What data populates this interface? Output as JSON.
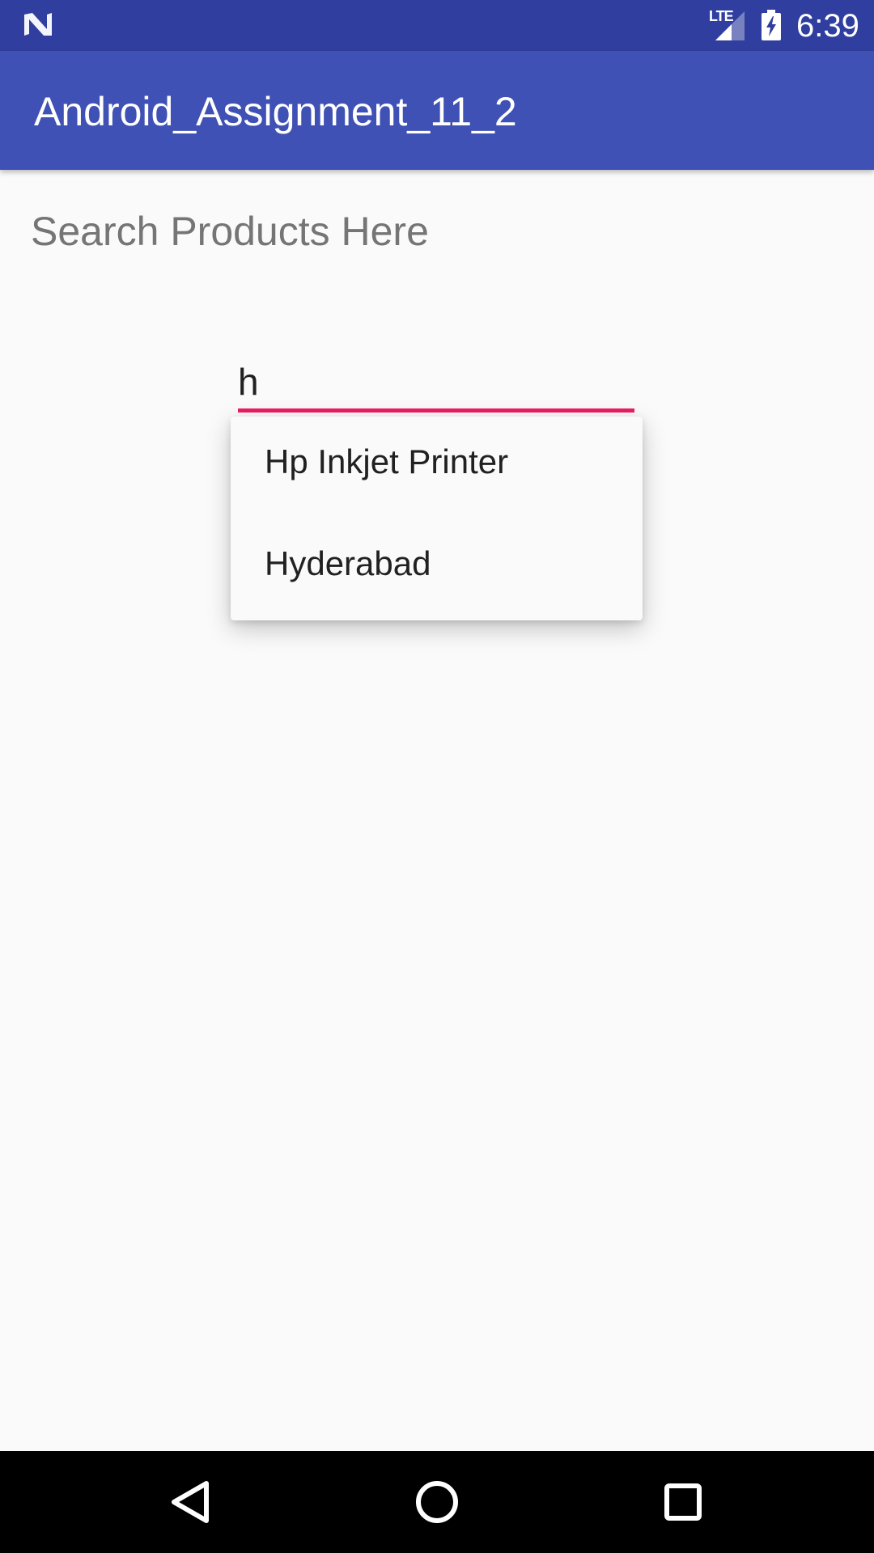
{
  "status_bar": {
    "network_label": "LTE",
    "time": "6:39",
    "icons": [
      "android-n-icon",
      "lte-signal-icon",
      "battery-charging-icon"
    ]
  },
  "app_bar": {
    "title": "Android_Assignment_11_2"
  },
  "main": {
    "search_label": "Search Products Here",
    "search_input_value": "h",
    "suggestions": [
      {
        "label": "Hp Inkjet Printer"
      },
      {
        "label": "Hyderabad"
      }
    ]
  },
  "nav_bar": {
    "buttons": [
      "back-icon",
      "home-icon",
      "recents-icon"
    ]
  },
  "colors": {
    "status_bar": "#303f9f",
    "app_bar": "#3f51b5",
    "accent": "#e91e63",
    "background": "#fafafa"
  }
}
